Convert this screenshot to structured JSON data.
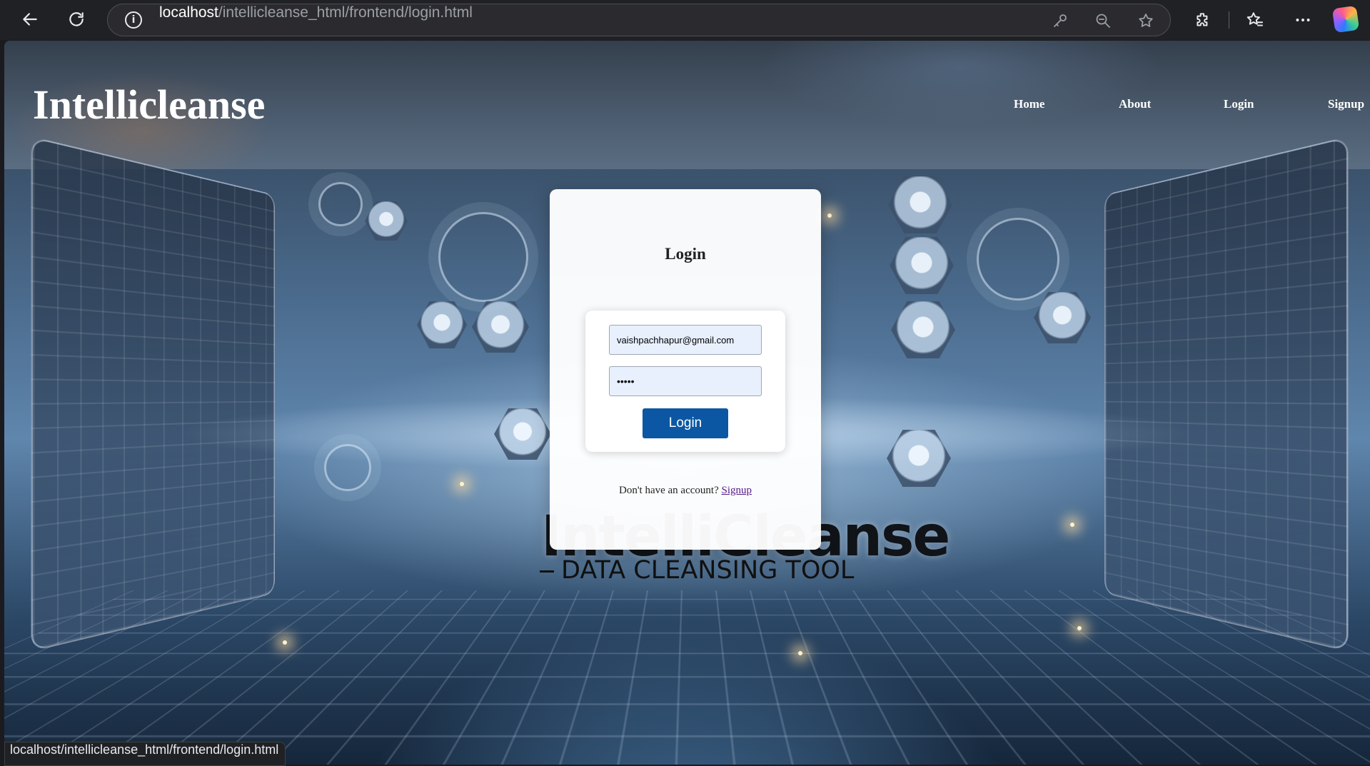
{
  "browser": {
    "url_host": "localhost",
    "url_path": "/intellicleanse_html/frontend/login.html",
    "status_url": "localhost/intellicleanse_html/frontend/login.html"
  },
  "site": {
    "logo": "Intellicleanse",
    "nav": [
      "Home",
      "About",
      "Login",
      "Signup"
    ]
  },
  "background": {
    "title": "IntelliCleanse",
    "subtitle": "DATA CLEANSING TOOL"
  },
  "login": {
    "title": "Login",
    "email_value": "vaishpachhapur@gmail.com",
    "password_value": "•••••",
    "button_label": "Login",
    "signup_prompt": "Don't have an account?",
    "signup_link": "Signup"
  },
  "colors": {
    "button": "#0b57a3",
    "link": "#551a8b",
    "input_bg": "#e8f0fe"
  }
}
